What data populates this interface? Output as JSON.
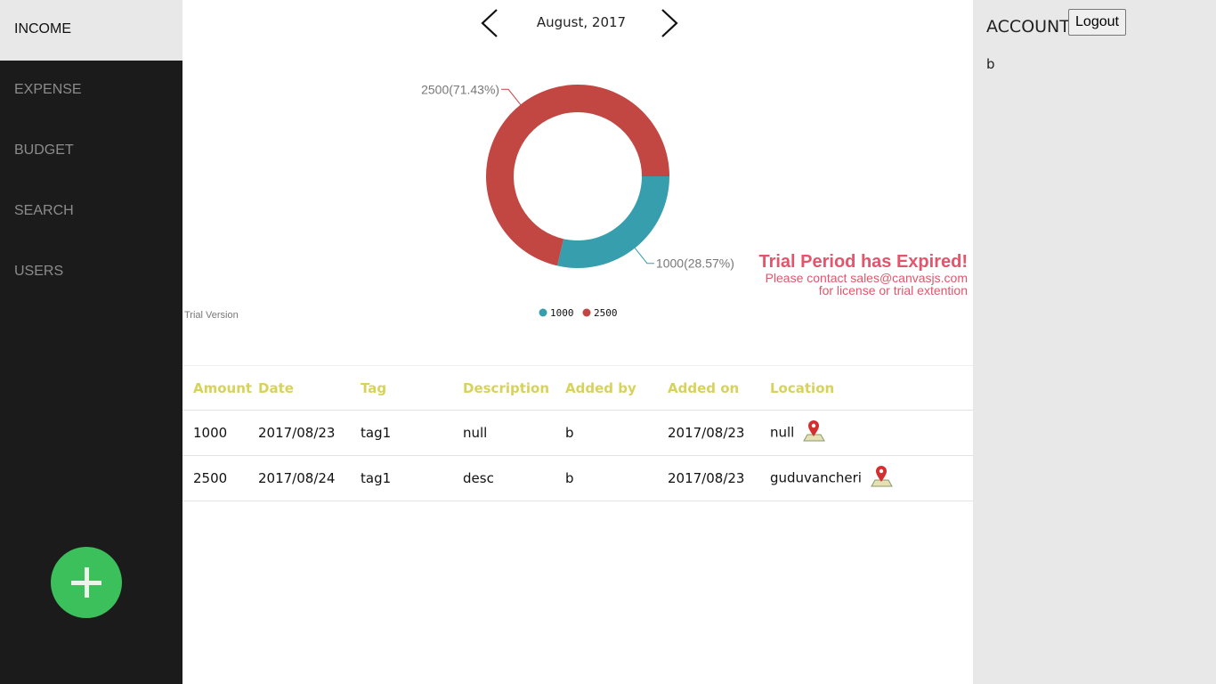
{
  "sidebar": {
    "items": [
      {
        "label": "INCOME"
      },
      {
        "label": "EXPENSE"
      },
      {
        "label": "BUDGET"
      },
      {
        "label": "SEARCH"
      },
      {
        "label": "USERS"
      }
    ],
    "active_index": 0
  },
  "month_nav": {
    "label": "August, 2017"
  },
  "chart": {
    "trial_version": "Trial Version",
    "trial_expired_title": "Trial Period has Expired!",
    "trial_expired_line1": "Please contact sales@canvasjs.com",
    "trial_expired_line2": "for license or trial extention"
  },
  "chart_data": {
    "type": "pie",
    "style": "doughnut",
    "categories": [
      "1000",
      "2500"
    ],
    "values": [
      1000,
      2500
    ],
    "percent_labels": [
      "1000(28.57%)",
      "2500(71.43%)"
    ],
    "colors": [
      "#369ead",
      "#c24642"
    ],
    "legend": "bottom-center"
  },
  "table": {
    "columns": [
      "Amount",
      "Date",
      "Tag",
      "Description",
      "Added by",
      "Added on",
      "Location"
    ],
    "rows": [
      [
        "1000",
        "2017/08/23",
        "tag1",
        "null",
        "b",
        "2017/08/23",
        "null"
      ],
      [
        "2500",
        "2017/08/24",
        "tag1",
        "desc",
        "b",
        "2017/08/23",
        "guduvancheri"
      ]
    ]
  },
  "account": {
    "title": "ACCOUNT",
    "logout_label": "Logout",
    "user": "b"
  },
  "icons": {
    "map_pin": "map-pin-icon",
    "add": "plus-icon"
  }
}
